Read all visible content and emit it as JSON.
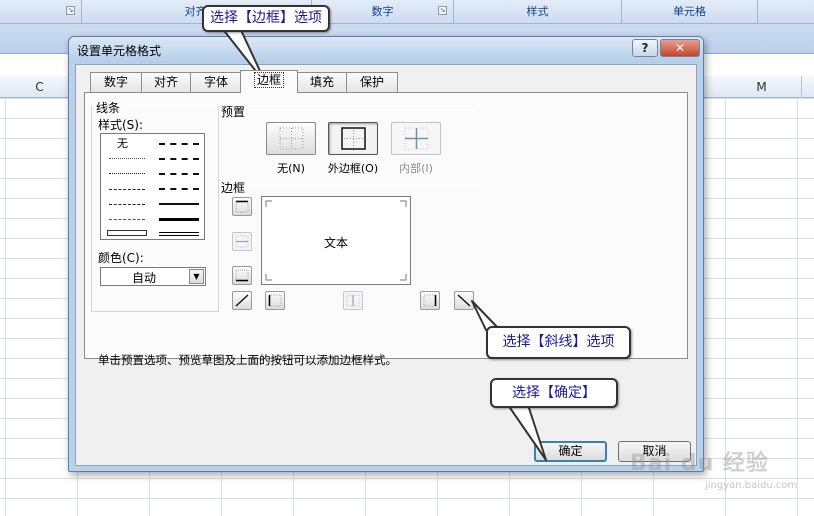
{
  "ribbon": {
    "groups": [
      {
        "label": "对齐方式"
      },
      {
        "label": "数字"
      },
      {
        "label": "样式"
      },
      {
        "label": "单元格"
      }
    ]
  },
  "sheet": {
    "columns": [
      "C",
      "M"
    ]
  },
  "dialog": {
    "title": "设置单元格格式",
    "help_symbol": "?",
    "close_symbol": "✕",
    "tabs": [
      {
        "label": "数字",
        "active": false
      },
      {
        "label": "对齐",
        "active": false
      },
      {
        "label": "字体",
        "active": false
      },
      {
        "label": "边框",
        "active": true
      },
      {
        "label": "填充",
        "active": false
      },
      {
        "label": "保护",
        "active": false
      }
    ],
    "line": {
      "section_label": "线条",
      "style_label": "样式(S):",
      "none_label": "无",
      "color_label": "颜色(C):",
      "color_value": "自动"
    },
    "presets": {
      "section_label": "预置",
      "items": [
        {
          "label": "无(N)",
          "enabled": true
        },
        {
          "label": "外边框(O)",
          "enabled": true
        },
        {
          "label": "内部(I)",
          "enabled": false
        }
      ]
    },
    "border": {
      "section_label": "边框",
      "preview_text": "文本"
    },
    "hint": "单击预置选项、预览草图及上面的按钮可以添加边框样式。",
    "ok_label": "确定",
    "cancel_label": "取消"
  },
  "callouts": {
    "tab": "选择【边框】选项",
    "diagonal": "选择【斜线】选项",
    "ok": "选择【确定】"
  },
  "watermark": {
    "brand": "Bai du 经验",
    "url": "jingyan.baidu.com"
  }
}
